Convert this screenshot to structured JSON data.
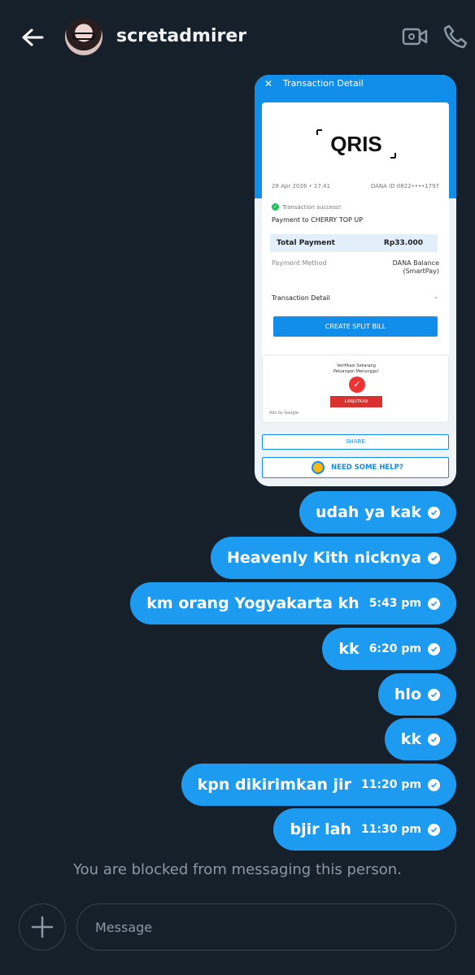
{
  "header": {
    "username": "scretadmirer"
  },
  "receipt": {
    "title": "Transaction Detail",
    "close": "✕",
    "logo": "QRIS",
    "date": "28 Apr 2026 • 17:41",
    "dana_id": "DANA ID 0822••••1797",
    "success": "Transaction success!",
    "payment_to": "Payment to CHERRY TOP UP",
    "total_label": "Total Payment",
    "total_value": "Rp33.000",
    "method_label": "Payment Method",
    "method_value_1": "DANA Balance",
    "method_value_2": "(SmartPay)",
    "detail_label": "Transaction Detail",
    "split_bill": "CREATE SPLIT BILL",
    "ad_title_1": "Verifikasi Sekarang",
    "ad_title_2": "Peluangan Menunggu!",
    "ad_button": "LANJUTKAN",
    "ad_by": "Ads by Google",
    "share": "SHARE",
    "help": "NEED SOME HELP?"
  },
  "messages": [
    {
      "text": "udah ya kak",
      "time": ""
    },
    {
      "text": "Heavenly Kith nicknya",
      "time": ""
    },
    {
      "text": "km orang Yogyakarta kh",
      "time": "5:43 pm"
    },
    {
      "text": "kk",
      "time": "6:20 pm"
    },
    {
      "text": "hlo",
      "time": ""
    },
    {
      "text": "kk",
      "time": ""
    },
    {
      "text": "kpn dikirimkan jir",
      "time": "11:20 pm"
    },
    {
      "text": "bjir lah",
      "time": "11:30 pm"
    }
  ],
  "blocked_notice": "You are blocked from messaging this person.",
  "composer": {
    "placeholder": "Message"
  },
  "colors": {
    "background": "#15202b",
    "bubble": "#1d9bf0",
    "muted": "#8b98a5"
  }
}
